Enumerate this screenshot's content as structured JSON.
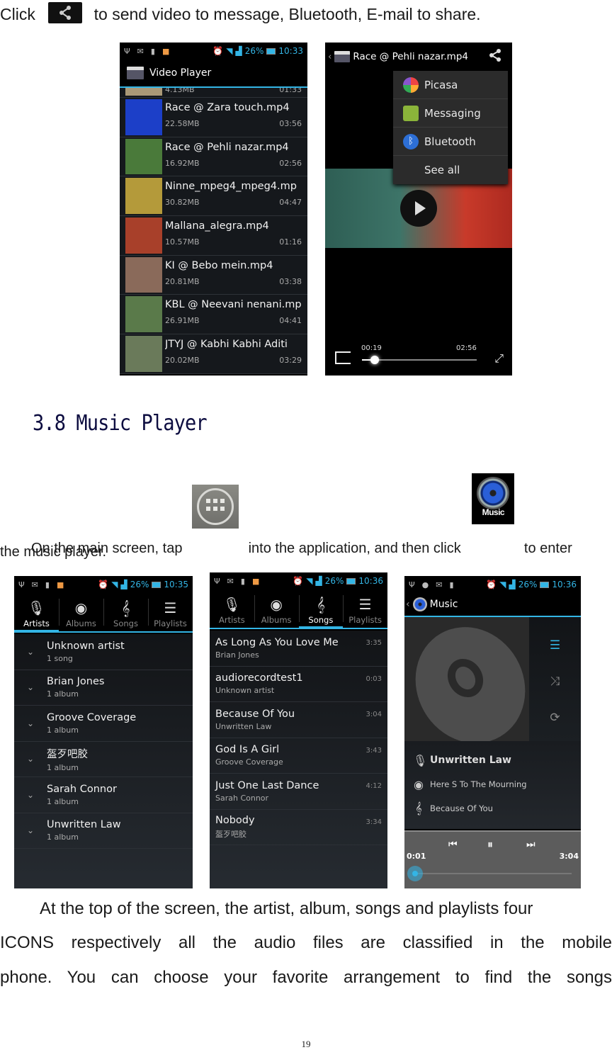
{
  "intro": {
    "click_word": "Click",
    "share_icon": "share-icon",
    "text": "to send video to message, Bluetooth, E-mail to share."
  },
  "video_list_screen": {
    "status_time": "10:33",
    "battery": "26%",
    "title": "Video Player",
    "partial_item": {
      "size": "4.13MB",
      "duration": "01:33"
    },
    "items": [
      {
        "title": "Race @ Zara touch.mp4",
        "size": "22.58MB",
        "duration": "03:56"
      },
      {
        "title": "Race @ Pehli nazar.mp4",
        "size": "16.92MB",
        "duration": "02:56"
      },
      {
        "title": "Ninne_mpeg4_mpeg4.mp",
        "size": "30.82MB",
        "duration": "04:47"
      },
      {
        "title": "Mallana_alegra.mp4",
        "size": "10.57MB",
        "duration": "01:16"
      },
      {
        "title": "KI @ Bebo mein.mp4",
        "size": "20.81MB",
        "duration": "03:38"
      },
      {
        "title": "KBL @ Neevani nenani.mp",
        "size": "26.91MB",
        "duration": "04:41"
      },
      {
        "title": "JTYJ @ Kabhi Kabhi Aditi",
        "size": "20.02MB",
        "duration": "03:29"
      }
    ]
  },
  "video_share_screen": {
    "title": "Race @ Pehli nazar.mp4",
    "share_menu": [
      {
        "label": "Picasa",
        "icon": "picasa-icon"
      },
      {
        "label": "Messaging",
        "icon": "messaging-icon"
      },
      {
        "label": "Bluetooth",
        "icon": "bluetooth-icon"
      },
      {
        "label": "See all",
        "icon": ""
      }
    ],
    "elapsed": "00:19",
    "total": "02:56",
    "progress_fraction": 0.11
  },
  "section": {
    "heading": "3.8 Music Player",
    "para1_a": "On the main screen, tap",
    "para1_b": "into the application, and then click",
    "para1_c": "to enter",
    "para1_d": "the music player.",
    "music_icon_label": "Music"
  },
  "artists_screen": {
    "status_time": "10:35",
    "battery": "26%",
    "tabs": [
      "Artists",
      "Albums",
      "Songs",
      "Playlists"
    ],
    "active_tab": "Artists",
    "items": [
      {
        "name": "Unknown artist",
        "sub": "1 song"
      },
      {
        "name": "Brian Jones",
        "sub": "1 album"
      },
      {
        "name": "Groove Coverage",
        "sub": "1 album"
      },
      {
        "name": "盔歹吧胶",
        "sub": "1 album"
      },
      {
        "name": "Sarah Connor",
        "sub": "1 album"
      },
      {
        "name": "Unwritten Law",
        "sub": "1 album"
      }
    ]
  },
  "songs_screen": {
    "status_time": "10:36",
    "battery": "26%",
    "tabs": [
      "Artists",
      "Albums",
      "Songs",
      "Playlists"
    ],
    "active_tab": "Songs",
    "items": [
      {
        "title": "As Long As You Love Me",
        "artist": "Brian Jones",
        "duration": "3:35"
      },
      {
        "title": "audiorecordtest1",
        "artist": "Unknown artist",
        "duration": "0:03"
      },
      {
        "title": "Because Of You",
        "artist": "Unwritten Law",
        "duration": "3:04"
      },
      {
        "title": "God Is A Girl",
        "artist": "Groove Coverage",
        "duration": "3:43"
      },
      {
        "title": "Just One Last Dance",
        "artist": "Sarah Connor",
        "duration": "4:12"
      },
      {
        "title": "Nobody",
        "artist": "盔歹吧胶",
        "duration": "3:34"
      }
    ]
  },
  "now_playing_screen": {
    "status_time": "10:36",
    "battery": "26%",
    "title": "Music",
    "artist": "Unwritten Law",
    "album": "Here S To The Mourning",
    "song": "Because Of You",
    "elapsed": "0:01",
    "total": "3:04",
    "progress_fraction": 0.005
  },
  "closing": {
    "line1": "At the top of the screen, the artist, album, songs and playlists four",
    "line2": "ICONS respectively all the audio files are classified in the mobile",
    "line3": "phone. You can choose your favorite arrangement to find the songs"
  },
  "page_number": "19",
  "colors": {
    "accent": "#33b5e5",
    "heading": "#0d0d40"
  }
}
